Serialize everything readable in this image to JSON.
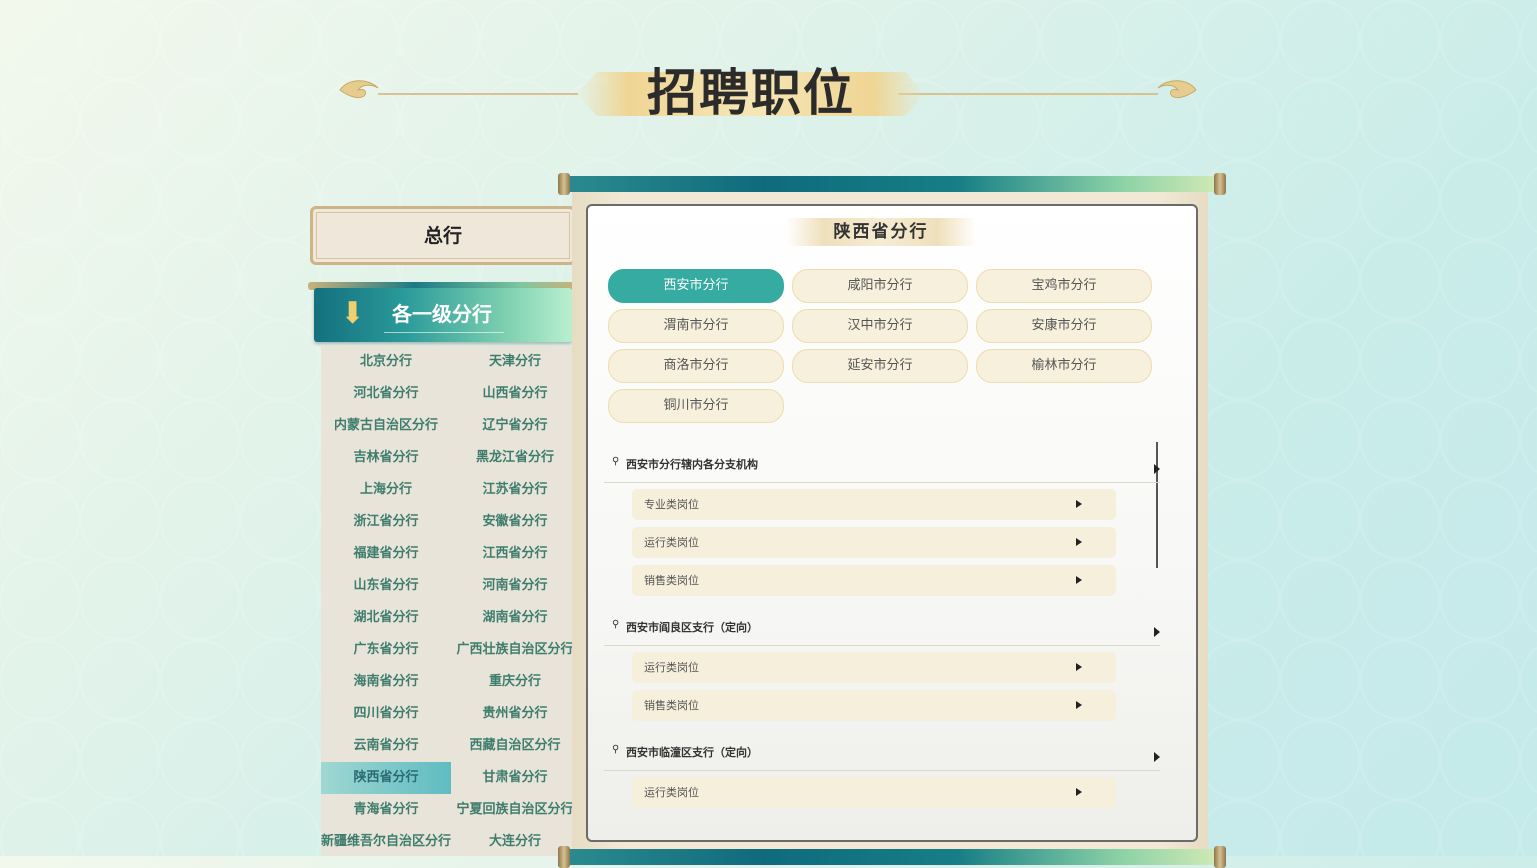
{
  "page_title": "招聘职位",
  "headquarters_label": "总行",
  "level1_header": "各一级分行",
  "level1_branches": [
    "北京分行",
    "天津分行",
    "河北省分行",
    "山西省分行",
    "内蒙古自治区分行",
    "辽宁省分行",
    "吉林省分行",
    "黑龙江省分行",
    "上海分行",
    "江苏省分行",
    "浙江省分行",
    "安徽省分行",
    "福建省分行",
    "江西省分行",
    "山东省分行",
    "河南省分行",
    "湖北省分行",
    "湖南省分行",
    "广东省分行",
    "广西壮族自治区分行",
    "海南省分行",
    "重庆分行",
    "四川省分行",
    "贵州省分行",
    "云南省分行",
    "西藏自治区分行",
    "陕西省分行",
    "甘肃省分行",
    "青海省分行",
    "宁夏回族自治区分行",
    "新疆维吾尔自治区分行",
    "大连分行"
  ],
  "active_branch": "陕西省分行",
  "panel": {
    "branch_title": "陕西省分行",
    "cities": [
      "西安市分行",
      "咸阳市分行",
      "宝鸡市分行",
      "渭南市分行",
      "汉中市分行",
      "安康市分行",
      "商洛市分行",
      "延安市分行",
      "榆林市分行",
      "铜川市分行"
    ],
    "active_city": "西安市分行",
    "groups": [
      {
        "title": "西安市分行辖内各分支机构",
        "positions": [
          "专业类岗位",
          "运行类岗位",
          "销售类岗位"
        ]
      },
      {
        "title": "西安市阎良区支行（定向）",
        "positions": [
          "运行类岗位",
          "销售类岗位"
        ]
      },
      {
        "title": "西安市临潼区支行（定向）",
        "positions": [
          "运行类岗位"
        ]
      }
    ]
  },
  "colors": {
    "accent_teal": "#35aba1",
    "nav_text": "#3e7d6e",
    "pill_bg": "#f7f0dc",
    "gold": "#efd594"
  },
  "icons": {
    "location": "location-pin-icon",
    "expand": "triangle-right-icon",
    "down_arrow": "down-arrow-icon"
  }
}
